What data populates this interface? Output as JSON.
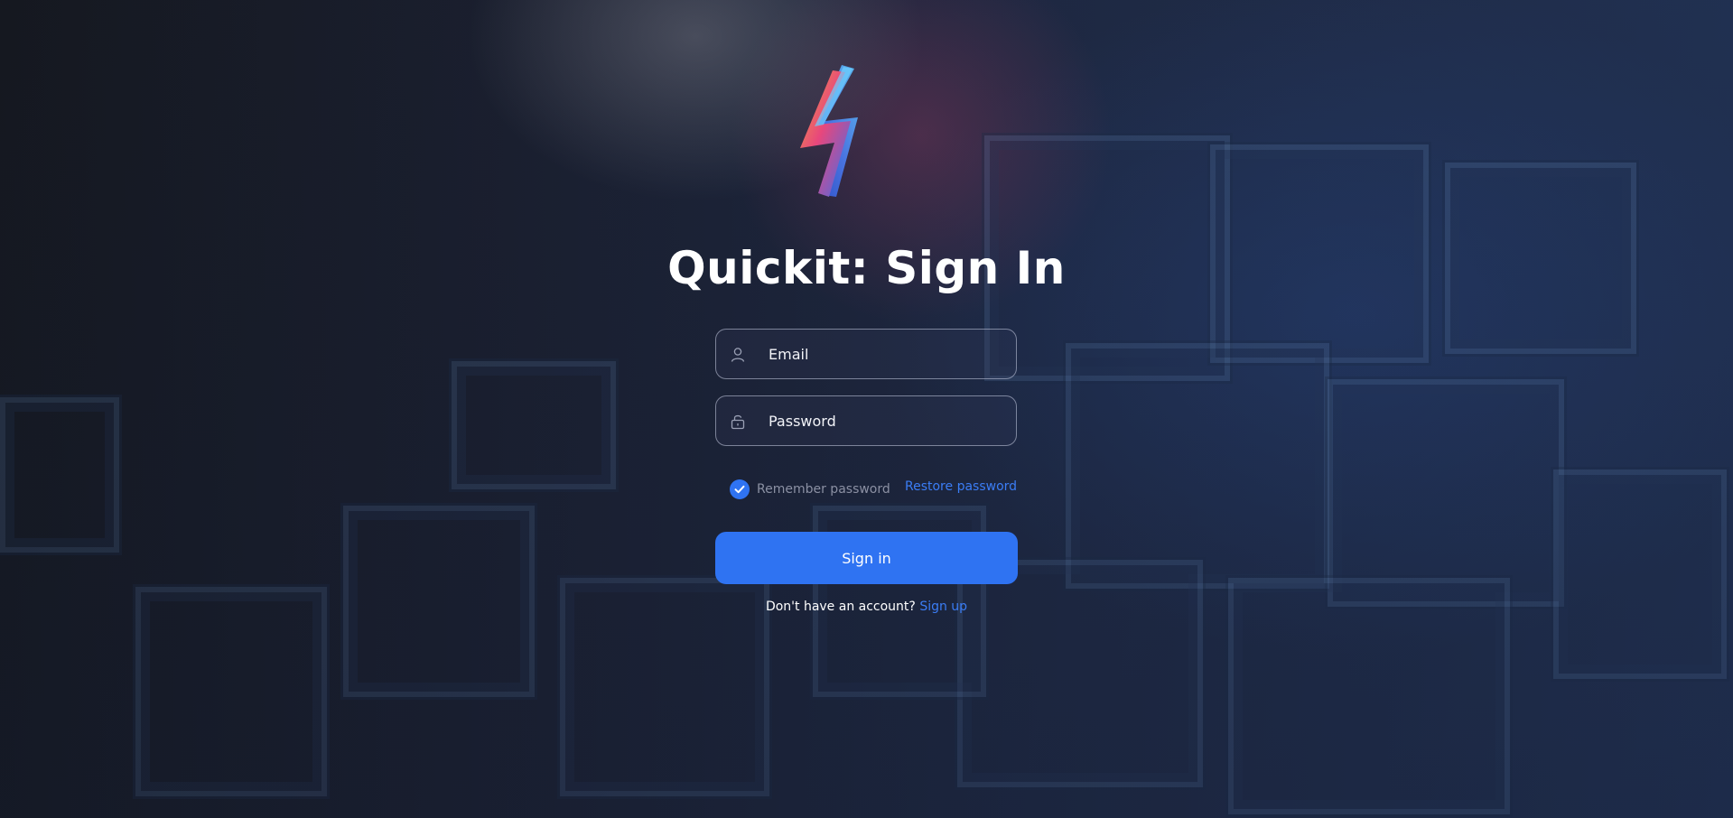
{
  "page": {
    "title": "Quickit: Sign In"
  },
  "logo": {
    "icon": "lightning-bolt-logo-icon"
  },
  "form": {
    "email": {
      "placeholder": "Email",
      "value": "",
      "icon": "user-icon"
    },
    "password": {
      "placeholder": "Password",
      "value": "",
      "icon": "lock-icon"
    },
    "remember": {
      "label": "Remember password",
      "checked": true
    },
    "restore_link": "Restore password",
    "submit_label": "Sign in",
    "signup_prompt": "Don't have an account?",
    "signup_link": "Sign up"
  },
  "colors": {
    "accent": "#2f73f2",
    "link": "#3b7df5",
    "muted_text": "#8b90a3",
    "text": "#ffffff"
  }
}
